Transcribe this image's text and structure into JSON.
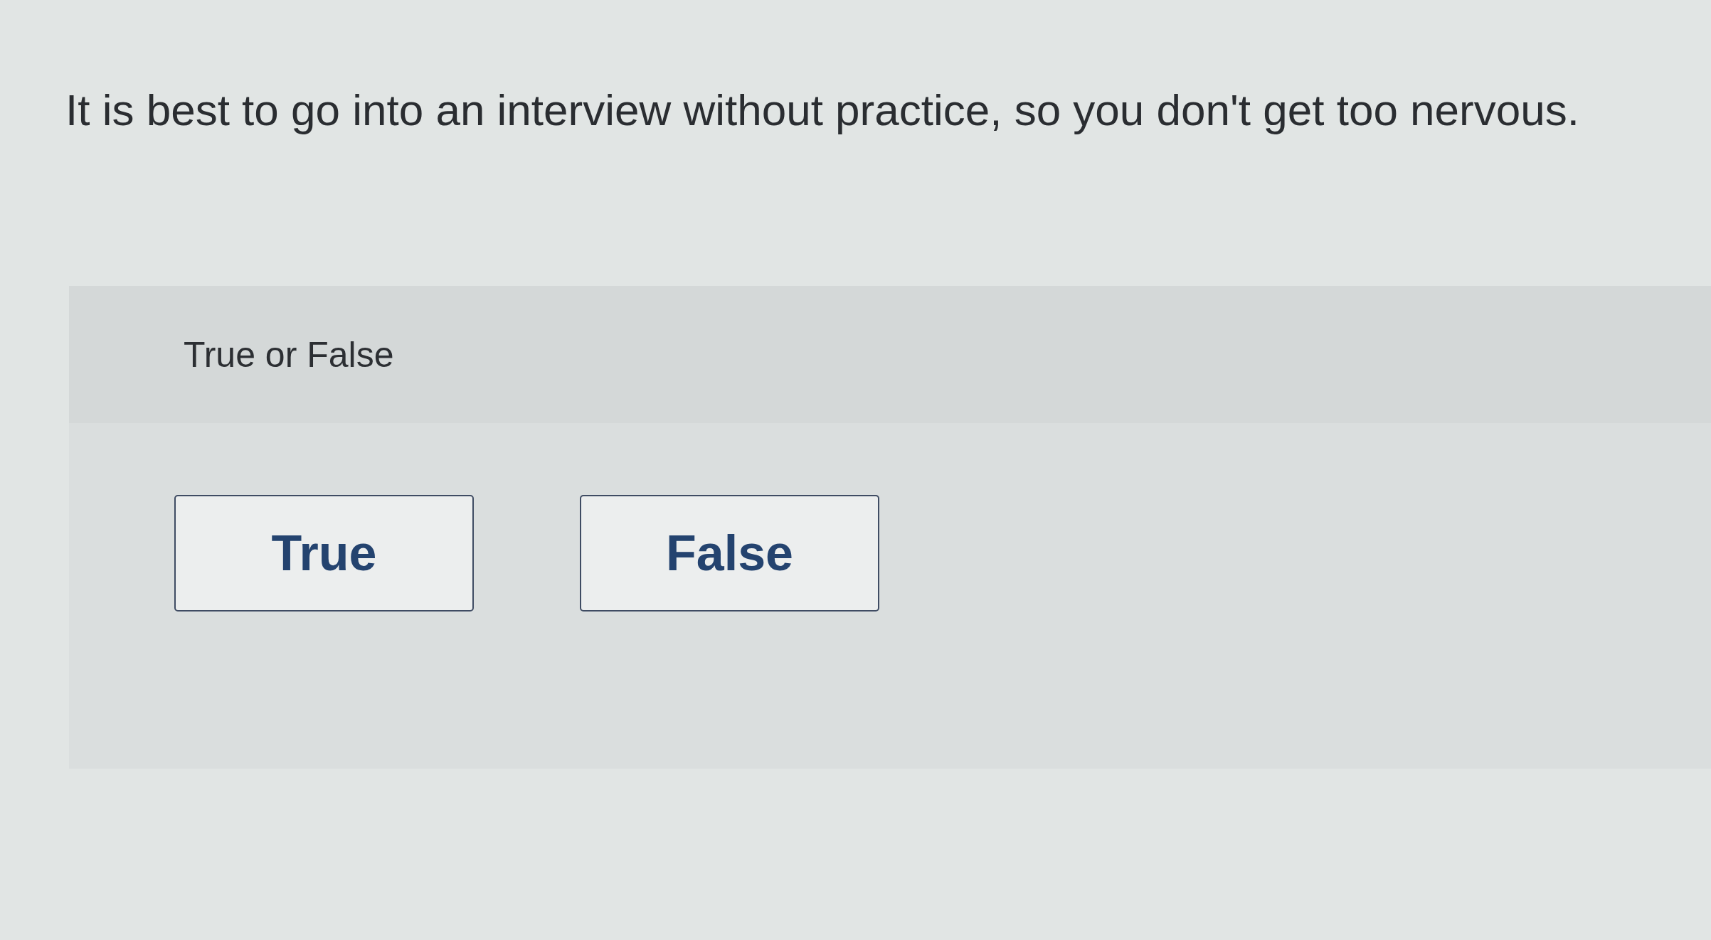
{
  "question": {
    "text": "It is best to go into an interview without practice, so you don't get too nervous."
  },
  "answer_panel": {
    "prompt": "True or False",
    "options": [
      {
        "label": "True",
        "selected": false
      },
      {
        "label": "False",
        "selected": false
      }
    ]
  }
}
